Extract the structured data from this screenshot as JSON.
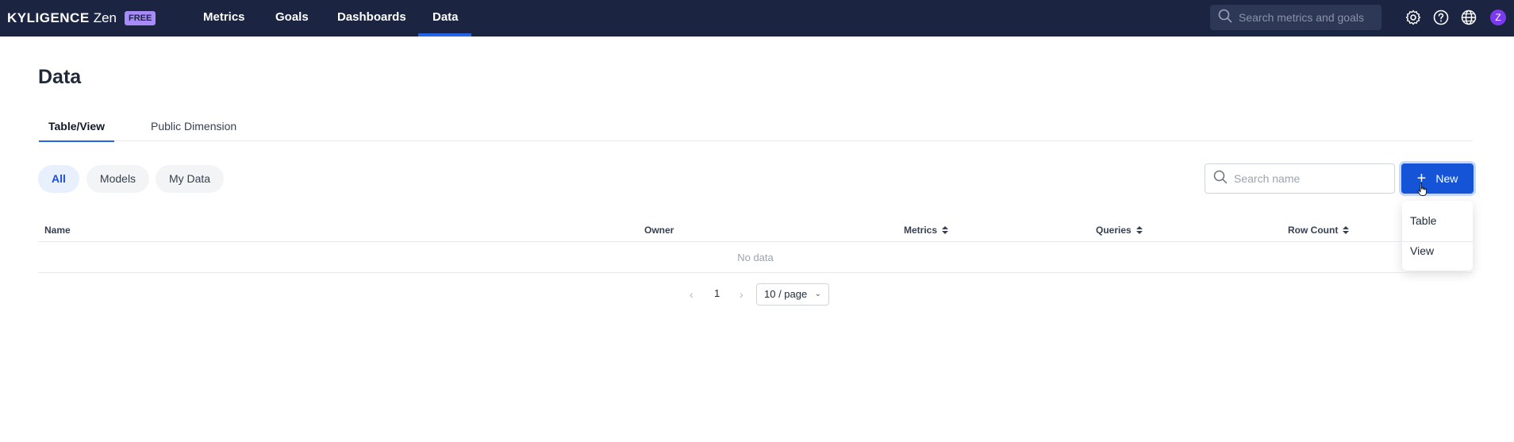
{
  "app": {
    "brand": "KYLIGENCE",
    "product": "Zen",
    "badge": "FREE"
  },
  "nav": {
    "items": [
      {
        "label": "Metrics"
      },
      {
        "label": "Goals"
      },
      {
        "label": "Dashboards"
      },
      {
        "label": "Data"
      }
    ],
    "active": "Data"
  },
  "top_search": {
    "placeholder": "Search metrics and goals",
    "value": ""
  },
  "top_icons": [
    "gear-icon",
    "help-icon",
    "globe-icon"
  ],
  "user": {
    "avatar_initial": "Z",
    "avatar_color": "#7c3aed"
  },
  "page": {
    "title": "Data"
  },
  "tabs": [
    {
      "label": "Table/View",
      "active": true
    },
    {
      "label": "Public Dimension",
      "active": false
    }
  ],
  "filters": [
    {
      "label": "All",
      "active": true
    },
    {
      "label": "Models",
      "active": false
    },
    {
      "label": "My Data",
      "active": false
    }
  ],
  "search_name": {
    "placeholder": "Search name",
    "value": ""
  },
  "new_button": {
    "label": "New"
  },
  "new_menu": {
    "items": [
      {
        "label": "Table"
      },
      {
        "label": "View"
      }
    ]
  },
  "table": {
    "columns": [
      {
        "label": "Name",
        "sortable": false
      },
      {
        "label": "Owner",
        "sortable": false
      },
      {
        "label": "Metrics",
        "sortable": true
      },
      {
        "label": "Queries",
        "sortable": true
      },
      {
        "label": "Row Count",
        "sortable": true
      }
    ],
    "empty_text": "No data"
  },
  "pagination": {
    "current_page": "1",
    "page_size": "10 / page"
  },
  "colors": {
    "topbar": "#1b2440",
    "accent": "#2563eb",
    "primary_button": "#1554d6",
    "badge": "#a78bfa"
  }
}
